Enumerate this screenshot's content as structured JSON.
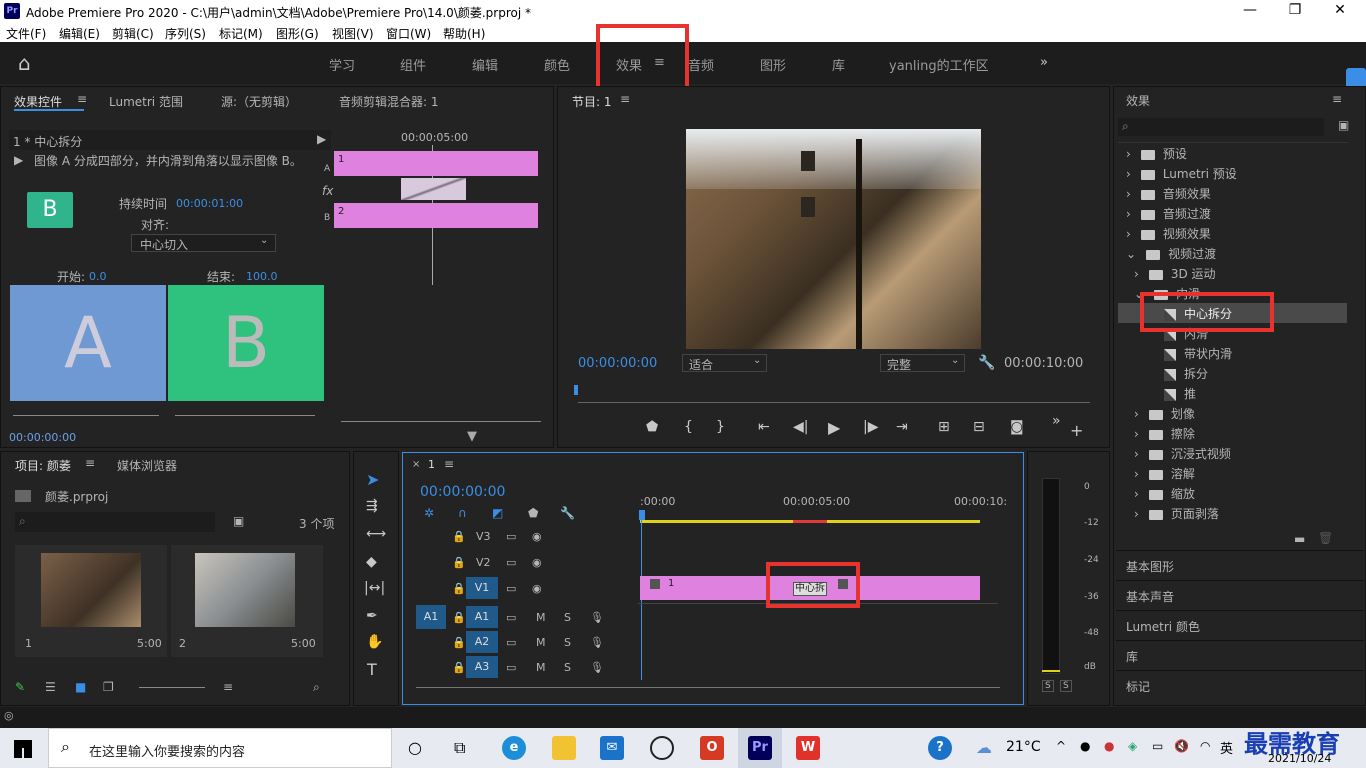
{
  "window": {
    "app_icon": "Pr",
    "title": "Adobe Premiere Pro 2020 - C:\\用户\\admin\\文档\\Adobe\\Premiere Pro\\14.0\\颜萎.prproj *",
    "min": "—",
    "max": "❐",
    "close": "✕"
  },
  "menu": [
    "文件(F)",
    "编辑(E)",
    "剪辑(C)",
    "序列(S)",
    "标记(M)",
    "图形(G)",
    "视图(V)",
    "窗口(W)",
    "帮助(H)"
  ],
  "workspaces": {
    "home": "⌂",
    "items": [
      "学习",
      "组件",
      "编辑",
      "颜色",
      "效果",
      "音频",
      "图形",
      "库",
      "yanling的工作区"
    ],
    "active": "效果",
    "more": "»"
  },
  "effect_controls": {
    "tabs": [
      "效果控件",
      "Lumetri 范围",
      "源:（无剪辑）",
      "音频剪辑混合器: 1"
    ],
    "clip": "1 * 中心拆分",
    "description": "图像 A 分成四部分，并内滑到角落以显示图像 B。",
    "thumb_letter": "B",
    "duration_label": "持续时间",
    "duration_value": "00:00:01:00",
    "align_label": "对齐:",
    "align_value": "中心切入",
    "start_label": "开始:",
    "start_value": "0.0",
    "end_label": "结束:",
    "end_value": "100.0",
    "a_label": "A",
    "b_label": "B",
    "timecode_ruler": "00:00:05:00",
    "track_a": "A",
    "track_b": "B",
    "fx": "fx",
    "clip_a": "1",
    "clip_b": "2",
    "bottom_time": "00:00:00:00"
  },
  "program": {
    "tab": "节目: 1",
    "timecode": "00:00:00:00",
    "fit": "适合",
    "quality": "完整",
    "duration": "00:00:10:00"
  },
  "project": {
    "tabs": [
      "项目: 颜萎",
      "媒体浏览器"
    ],
    "file": "颜萎.prproj",
    "count": "3 个项",
    "items": [
      {
        "num": "1",
        "dur": "5:00"
      },
      {
        "num": "2",
        "dur": "5:00"
      }
    ]
  },
  "timeline": {
    "tab": "1",
    "timecode": "00:00:00:00",
    "ruler": [
      ":00:00",
      "00:00:05:00",
      "00:00:10:"
    ],
    "video_tracks": [
      "V3",
      "V2",
      "V1"
    ],
    "audio_tracks": [
      "A1",
      "A2",
      "A3"
    ],
    "src_patch": "A1",
    "m": "M",
    "s": "S",
    "clip_label": "1",
    "transition_label": "中心拆"
  },
  "meter": {
    "scale": [
      "0",
      "-12",
      "-24",
      "-36",
      "-48",
      "dB"
    ],
    "solo": [
      "S",
      "S"
    ]
  },
  "effects": {
    "title": "效果",
    "folders": [
      "预设",
      "Lumetri 预设",
      "音频效果",
      "音频过渡",
      "视频效果",
      "视频过渡"
    ],
    "sub_folders_top": [
      "3D 运动",
      "内滑"
    ],
    "slide_items": [
      "中心拆分",
      "内滑",
      "带状内滑",
      "拆分",
      "推"
    ],
    "sub_folders_bottom": [
      "划像",
      "擦除",
      "沉浸式视频",
      "溶解",
      "缩放",
      "页面剥落"
    ]
  },
  "side_panels": [
    "基本图形",
    "基本声音",
    "Lumetri 颜色",
    "库",
    "标记"
  ],
  "taskbar": {
    "search_placeholder": "在这里输入你要搜索的内容",
    "weather": "21°C",
    "ime": "英",
    "date": "2021/10/24",
    "watermark": "最需教育"
  }
}
